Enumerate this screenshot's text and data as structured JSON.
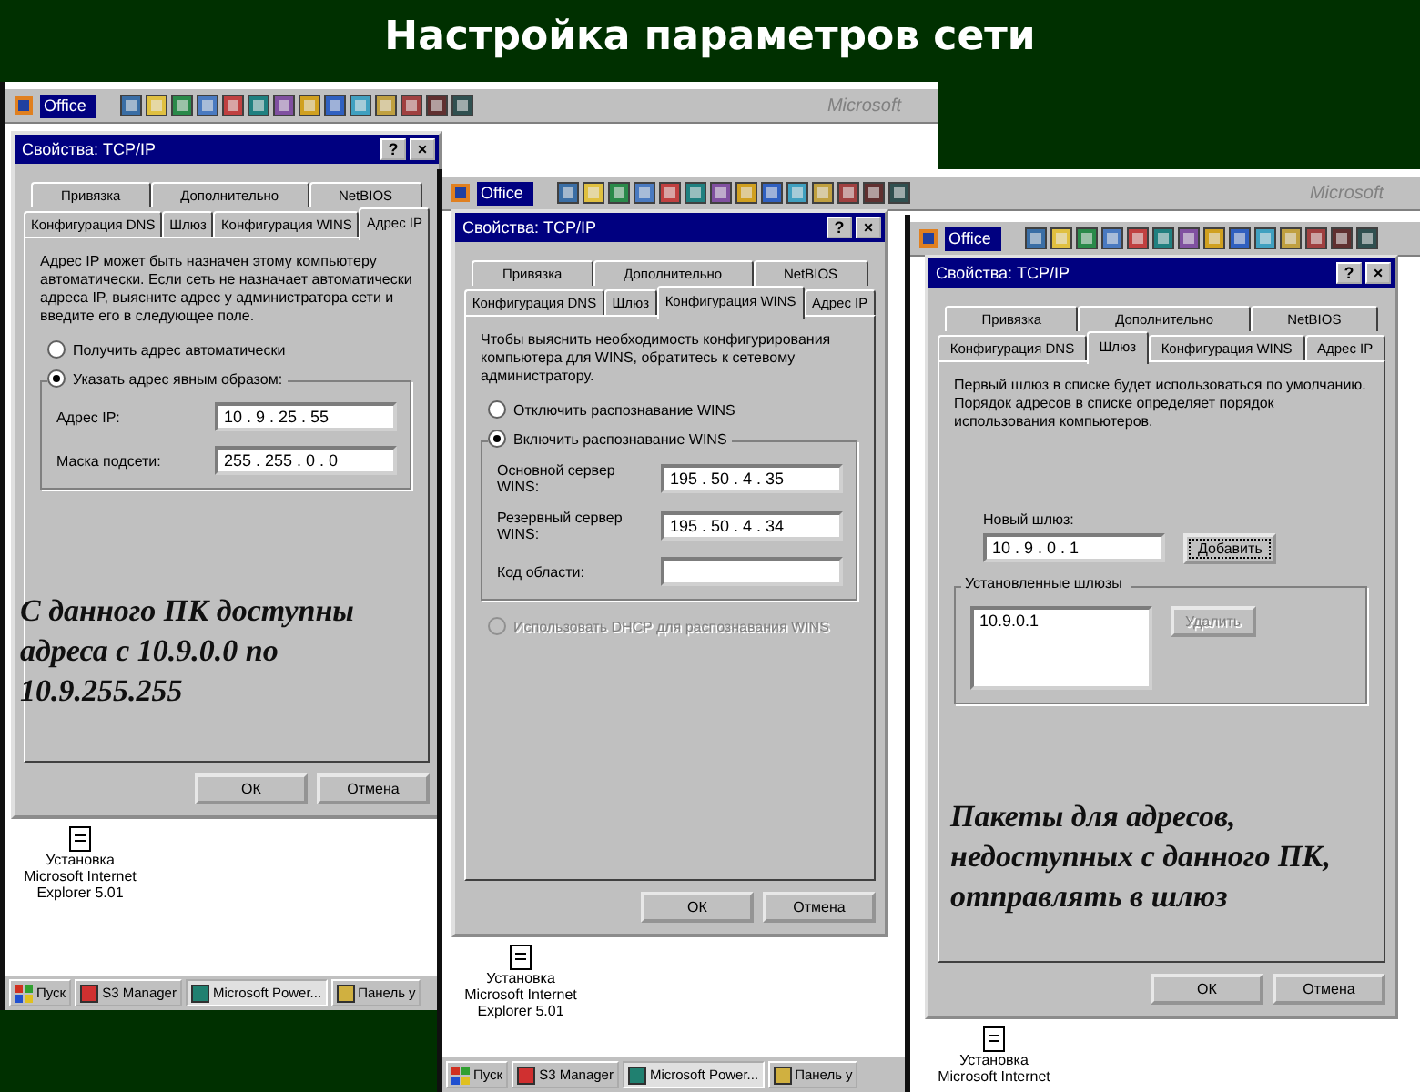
{
  "slide_title": "Настройка параметров сети",
  "screens": [
    {
      "office_bar": {
        "label": "Office",
        "brand": "Microsoft"
      },
      "dialog": {
        "title": "Свойства: TCP/IP",
        "title_buttons": [
          "?",
          "×"
        ],
        "tab_rows": [
          [
            {
              "label": "Привязка",
              "selected": false
            },
            {
              "label": "Дополнительно",
              "selected": false
            },
            {
              "label": "NetBIOS",
              "selected": false
            }
          ],
          [
            {
              "label": "Конфигурация DNS",
              "selected": false
            },
            {
              "label": "Шлюз",
              "selected": false
            },
            {
              "label": "Конфигурация WINS",
              "selected": false
            },
            {
              "label": "Адрес IP",
              "selected": true
            }
          ]
        ],
        "content": [
          {
            "kind": "text",
            "text": "Адрес IP может быть назначен этому компьютеру автоматически. Если сеть не назначает автоматически адреса IP, выясните адрес у администратора сети и введите его в следующее поле."
          },
          {
            "kind": "radio",
            "label": "Получить адрес автоматически",
            "checked": false,
            "disabled": false
          },
          {
            "kind": "group",
            "legend_radio": {
              "label": "Указать адрес явным образом:",
              "checked": true,
              "disabled": false
            },
            "items": [
              {
                "kind": "field",
                "label": "Адрес IP:",
                "value": "10 . 9 . 25 . 55"
              },
              {
                "kind": "field",
                "label": "Маска подсети:",
                "value": "255 . 255 . 0 . 0"
              }
            ]
          }
        ],
        "buttons": [
          {
            "label": "ОК"
          },
          {
            "label": "Отмена"
          }
        ]
      },
      "annotation": "С данного ПК доступны адреса с 10.9.0.0  по 10.9.255.255",
      "desktop_icon": "Установка Microsoft Internet Explorer 5.01",
      "taskbar": {
        "start": "Пуск",
        "tasks": [
          {
            "label": "S3 Manager",
            "selected": false
          },
          {
            "label": "Microsoft Power...",
            "selected": true
          },
          {
            "label": "Панель у",
            "selected": false
          }
        ]
      }
    },
    {
      "office_bar": {
        "label": "Office",
        "brand": "Microsoft"
      },
      "dialog": {
        "title": "Свойства: TCP/IP",
        "title_buttons": [
          "?",
          "×"
        ],
        "tab_rows": [
          [
            {
              "label": "Привязка",
              "selected": false
            },
            {
              "label": "Дополнительно",
              "selected": false
            },
            {
              "label": "NetBIOS",
              "selected": false
            }
          ],
          [
            {
              "label": "Конфигурация DNS",
              "selected": false
            },
            {
              "label": "Шлюз",
              "selected": false
            },
            {
              "label": "Конфигурация WINS",
              "selected": true
            },
            {
              "label": "Адрес IP",
              "selected": false
            }
          ]
        ],
        "content": [
          {
            "kind": "text",
            "text": "Чтобы выяснить необходимость конфигурирования компьютера для WINS, обратитесь к сетевому администратору."
          },
          {
            "kind": "radio",
            "label": "Отключить распознавание WINS",
            "checked": false,
            "disabled": false
          },
          {
            "kind": "group",
            "legend_radio": {
              "label": "Включить распознавание WINS",
              "checked": true,
              "disabled": false
            },
            "items": [
              {
                "kind": "field",
                "label": "Основной сервер WINS:",
                "value": "195 . 50 . 4 . 35"
              },
              {
                "kind": "field",
                "label": "Резервный сервер WINS:",
                "value": "195 . 50 . 4 . 34"
              },
              {
                "kind": "field",
                "label": "Код области:"
              }
            ]
          },
          {
            "kind": "radio",
            "label": "Использовать DHCP для распознавания WINS",
            "checked": false,
            "disabled": true
          }
        ],
        "buttons": [
          {
            "label": "ОК"
          },
          {
            "label": "Отмена"
          }
        ]
      },
      "desktop_icon": "Установка Microsoft Internet Explorer 5.01",
      "taskbar": {
        "start": "Пуск",
        "tasks": [
          {
            "label": "S3 Manager",
            "selected": false
          },
          {
            "label": "Microsoft Power...",
            "selected": true
          },
          {
            "label": "Панель у",
            "selected": false
          }
        ]
      }
    },
    {
      "office_bar": {
        "label": "Office"
      },
      "dialog": {
        "title": "Свойства: TCP/IP",
        "title_buttons": [
          "?",
          "×"
        ],
        "tab_rows": [
          [
            {
              "label": "Привязка",
              "selected": false
            },
            {
              "label": "Дополнительно",
              "selected": false
            },
            {
              "label": "NetBIOS",
              "selected": false
            }
          ],
          [
            {
              "label": "Конфигурация DNS",
              "selected": false
            },
            {
              "label": "Шлюз",
              "selected": true
            },
            {
              "label": "Конфигурация WINS",
              "selected": false
            },
            {
              "label": "Адрес IP",
              "selected": false
            }
          ]
        ],
        "content": [
          {
            "kind": "text",
            "text": "Первый шлюз в списке будет использоваться по умолчанию. Порядок адресов в списке определяет порядок использования компьютеров."
          },
          {
            "kind": "new_entry",
            "label": "Новый шлюз:",
            "value": "10 . 9 . 0 . 1",
            "button": {
              "label": "Добавить",
              "disabled": false
            }
          },
          {
            "kind": "group",
            "legend": "Установленные шлюзы",
            "items": [
              {
                "kind": "list",
                "entries": [
                  "10.9.0.1"
                ],
                "button": {
                  "label": "Удалить",
                  "disabled": true
                }
              }
            ]
          }
        ],
        "buttons": [
          {
            "label": "ОК"
          },
          {
            "label": "Отмена"
          }
        ]
      },
      "annotation": "Пакеты для адресов, недоступных с данного ПК, отправлять в шлюз",
      "desktop_icon": "Установка Microsoft Internet"
    }
  ]
}
